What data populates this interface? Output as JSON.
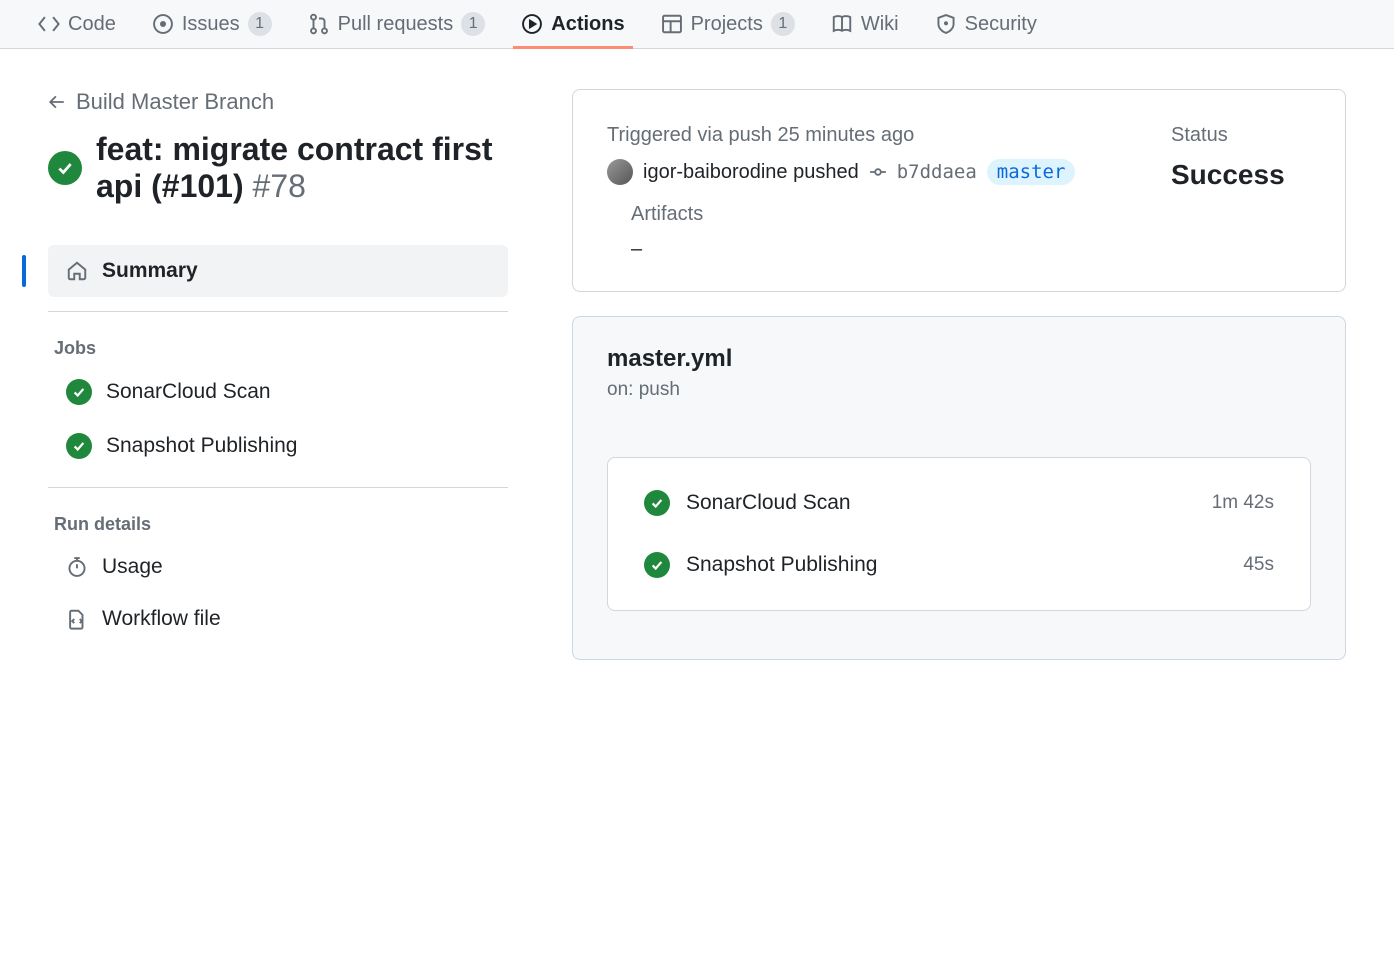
{
  "nav": {
    "code": "Code",
    "issues": "Issues",
    "issues_count": "1",
    "pulls": "Pull requests",
    "pulls_count": "1",
    "actions": "Actions",
    "projects": "Projects",
    "projects_count": "1",
    "wiki": "Wiki",
    "security": "Security"
  },
  "breadcrumb": {
    "back_label": "Build Master Branch"
  },
  "title": {
    "text": "feat: migrate contract first api (#101)",
    "run_number": "#78"
  },
  "sidebar": {
    "summary": "Summary",
    "jobs_header": "Jobs",
    "jobs": [
      {
        "name": "SonarCloud Scan"
      },
      {
        "name": "Snapshot Publishing"
      }
    ],
    "run_details_header": "Run details",
    "usage": "Usage",
    "workflow_file": "Workflow file"
  },
  "summary": {
    "trigger_prefix": "Triggered via push ",
    "trigger_time": "25 minutes ago",
    "actor": "igor-baiborodine",
    "pushed_word": " pushed",
    "commit": "b7ddaea",
    "branch": "master",
    "status_label": "Status",
    "status_value": "Success",
    "artifacts_label": "Artifacts",
    "artifacts_value": "–"
  },
  "workflow": {
    "file": "master.yml",
    "on_line": "on: push",
    "jobs": [
      {
        "name": "SonarCloud Scan",
        "time": "1m 42s"
      },
      {
        "name": "Snapshot Publishing",
        "time": "45s"
      }
    ]
  }
}
